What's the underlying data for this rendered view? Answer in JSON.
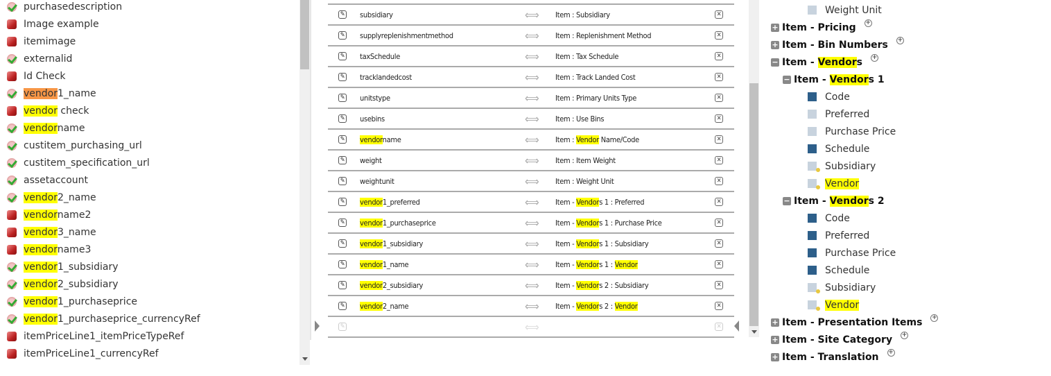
{
  "left_fields": [
    {
      "icon": "check",
      "parts": [
        [
          "purchasedescription",
          ""
        ]
      ]
    },
    {
      "icon": "cube",
      "parts": [
        [
          "Image example",
          ""
        ]
      ]
    },
    {
      "icon": "cube",
      "parts": [
        [
          "itemimage",
          ""
        ]
      ]
    },
    {
      "icon": "check",
      "parts": [
        [
          "externalid",
          ""
        ]
      ]
    },
    {
      "icon": "cube",
      "parts": [
        [
          "Id Check",
          ""
        ]
      ]
    },
    {
      "icon": "check",
      "parts": [
        [
          "vendor",
          "o"
        ],
        [
          "1_name",
          ""
        ]
      ]
    },
    {
      "icon": "cube",
      "parts": [
        [
          "vendor",
          "y"
        ],
        [
          " check",
          ""
        ]
      ]
    },
    {
      "icon": "check",
      "parts": [
        [
          "vendor",
          "y"
        ],
        [
          "name",
          ""
        ]
      ]
    },
    {
      "icon": "check",
      "parts": [
        [
          "custitem_purchasing_url",
          ""
        ]
      ]
    },
    {
      "icon": "check",
      "parts": [
        [
          "custitem_specification_url",
          ""
        ]
      ]
    },
    {
      "icon": "check",
      "parts": [
        [
          "assetaccount",
          ""
        ]
      ]
    },
    {
      "icon": "check",
      "parts": [
        [
          "vendor",
          "y"
        ],
        [
          "2_name",
          ""
        ]
      ]
    },
    {
      "icon": "cube",
      "parts": [
        [
          "vendor",
          "y"
        ],
        [
          "name2",
          ""
        ]
      ]
    },
    {
      "icon": "cube",
      "parts": [
        [
          "vendor",
          "y"
        ],
        [
          "3_name",
          ""
        ]
      ]
    },
    {
      "icon": "cube",
      "parts": [
        [
          "vendor",
          "y"
        ],
        [
          "name3",
          ""
        ]
      ]
    },
    {
      "icon": "check",
      "parts": [
        [
          "vendor",
          "y"
        ],
        [
          "1_subsidiary",
          ""
        ]
      ]
    },
    {
      "icon": "check",
      "parts": [
        [
          "vendor",
          "y"
        ],
        [
          "2_subsidiary",
          ""
        ]
      ]
    },
    {
      "icon": "check",
      "parts": [
        [
          "vendor",
          "y"
        ],
        [
          "1_purchaseprice",
          ""
        ]
      ]
    },
    {
      "icon": "check",
      "parts": [
        [
          "vendor",
          "y"
        ],
        [
          "1_purchaseprice_currencyRef",
          ""
        ]
      ]
    },
    {
      "icon": "cube",
      "parts": [
        [
          "itemPriceLine1_itemPriceTypeRef",
          ""
        ]
      ]
    },
    {
      "icon": "cube",
      "parts": [
        [
          "itemPriceLine1_currencyRef",
          ""
        ]
      ]
    }
  ],
  "mappings": [
    {
      "src": [
        [
          "subsidiary",
          ""
        ]
      ],
      "tgt": [
        [
          "Item : Subsidiary",
          ""
        ]
      ]
    },
    {
      "src": [
        [
          "supplyreplenishmentmethod",
          ""
        ]
      ],
      "tgt": [
        [
          "Item : Replenishment Method",
          ""
        ]
      ]
    },
    {
      "src": [
        [
          "taxSchedule",
          ""
        ]
      ],
      "tgt": [
        [
          "Item : Tax Schedule",
          ""
        ]
      ]
    },
    {
      "src": [
        [
          "tracklandedcost",
          ""
        ]
      ],
      "tgt": [
        [
          "Item : Track Landed Cost",
          ""
        ]
      ]
    },
    {
      "src": [
        [
          "unitstype",
          ""
        ]
      ],
      "tgt": [
        [
          "Item : Primary Units Type",
          ""
        ]
      ]
    },
    {
      "src": [
        [
          "usebins",
          ""
        ]
      ],
      "tgt": [
        [
          "Item : Use Bins",
          ""
        ]
      ]
    },
    {
      "src": [
        [
          "vendor",
          "y"
        ],
        [
          "name",
          ""
        ]
      ],
      "tgt": [
        [
          "Item : ",
          ""
        ],
        [
          "Vendor",
          "y"
        ],
        [
          " Name/Code",
          ""
        ]
      ]
    },
    {
      "src": [
        [
          "weight",
          ""
        ]
      ],
      "tgt": [
        [
          "Item : Item Weight",
          ""
        ]
      ]
    },
    {
      "src": [
        [
          "weightunit",
          ""
        ]
      ],
      "tgt": [
        [
          "Item : Weight Unit",
          ""
        ]
      ]
    },
    {
      "src": [
        [
          "vendor",
          "y"
        ],
        [
          "1_preferred",
          ""
        ]
      ],
      "tgt": [
        [
          "Item - ",
          ""
        ],
        [
          "Vendor",
          "y"
        ],
        [
          "s 1 : Preferred",
          ""
        ]
      ]
    },
    {
      "src": [
        [
          "vendor",
          "y"
        ],
        [
          "1_purchaseprice",
          ""
        ]
      ],
      "tgt": [
        [
          "Item - ",
          ""
        ],
        [
          "Vendor",
          "y"
        ],
        [
          "s 1 : Purchase Price",
          ""
        ]
      ]
    },
    {
      "src": [
        [
          "vendor",
          "y"
        ],
        [
          "1_subsidiary",
          ""
        ]
      ],
      "tgt": [
        [
          "Item - ",
          ""
        ],
        [
          "Vendor",
          "y"
        ],
        [
          "s 1 : Subsidiary",
          ""
        ]
      ]
    },
    {
      "src": [
        [
          "vendor",
          "y"
        ],
        [
          "1_name",
          ""
        ]
      ],
      "tgt": [
        [
          "Item - ",
          ""
        ],
        [
          "Vendor",
          "y"
        ],
        [
          "s 1 : ",
          ""
        ],
        [
          "Vendor",
          "y"
        ]
      ]
    },
    {
      "src": [
        [
          "vendor",
          "y"
        ],
        [
          "2_subsidiary",
          ""
        ]
      ],
      "tgt": [
        [
          "Item - ",
          ""
        ],
        [
          "Vendor",
          "y"
        ],
        [
          "s 2 : Subsidiary",
          ""
        ]
      ]
    },
    {
      "src": [
        [
          "vendor",
          "y"
        ],
        [
          "2_name",
          ""
        ]
      ],
      "tgt": [
        [
          "Item - ",
          ""
        ],
        [
          "Vendor",
          "y"
        ],
        [
          "s 2 : ",
          ""
        ],
        [
          "Vendor",
          "y"
        ]
      ]
    }
  ],
  "icons": {
    "edit": "✎",
    "arrow": "⟺",
    "delete": "✕",
    "plus": "+",
    "minus": "−",
    "add": "+"
  },
  "tree": [
    {
      "kind": "field",
      "icon": "light",
      "level": 2,
      "parts": [
        [
          "Weight Unit",
          ""
        ]
      ]
    },
    {
      "kind": "group",
      "state": "plus",
      "level": 0,
      "add": true,
      "parts": [
        [
          "Item - Pricing",
          ""
        ]
      ]
    },
    {
      "kind": "group",
      "state": "plus",
      "level": 0,
      "add": true,
      "parts": [
        [
          "Item - Bin Numbers",
          ""
        ]
      ]
    },
    {
      "kind": "group",
      "state": "minus",
      "level": 0,
      "add": true,
      "parts": [
        [
          "Item - ",
          ""
        ],
        [
          "Vendor",
          "y"
        ],
        [
          "s",
          ""
        ]
      ]
    },
    {
      "kind": "group",
      "state": "minus",
      "level": 1,
      "add": false,
      "parts": [
        [
          "Item - ",
          ""
        ],
        [
          "Vendor",
          "y"
        ],
        [
          "s 1",
          ""
        ]
      ]
    },
    {
      "kind": "field",
      "icon": "dark",
      "level": 2,
      "parts": [
        [
          "Code",
          ""
        ]
      ]
    },
    {
      "kind": "field",
      "icon": "light",
      "level": 2,
      "parts": [
        [
          "Preferred",
          ""
        ]
      ]
    },
    {
      "kind": "field",
      "icon": "light",
      "level": 2,
      "parts": [
        [
          "Purchase Price",
          ""
        ]
      ]
    },
    {
      "kind": "field",
      "icon": "dark",
      "level": 2,
      "parts": [
        [
          "Schedule",
          ""
        ]
      ]
    },
    {
      "kind": "field",
      "icon": "key",
      "level": 2,
      "parts": [
        [
          "Subsidiary",
          ""
        ]
      ]
    },
    {
      "kind": "field",
      "icon": "key",
      "level": 2,
      "parts": [
        [
          "Vendor",
          "y"
        ]
      ]
    },
    {
      "kind": "group",
      "state": "minus",
      "level": 1,
      "add": false,
      "parts": [
        [
          "Item - ",
          ""
        ],
        [
          "Vendor",
          "y"
        ],
        [
          "s 2",
          ""
        ]
      ]
    },
    {
      "kind": "field",
      "icon": "dark",
      "level": 2,
      "parts": [
        [
          "Code",
          ""
        ]
      ]
    },
    {
      "kind": "field",
      "icon": "dark",
      "level": 2,
      "parts": [
        [
          "Preferred",
          ""
        ]
      ]
    },
    {
      "kind": "field",
      "icon": "dark",
      "level": 2,
      "parts": [
        [
          "Purchase Price",
          ""
        ]
      ]
    },
    {
      "kind": "field",
      "icon": "dark",
      "level": 2,
      "parts": [
        [
          "Schedule",
          ""
        ]
      ]
    },
    {
      "kind": "field",
      "icon": "key",
      "level": 2,
      "parts": [
        [
          "Subsidiary",
          ""
        ]
      ]
    },
    {
      "kind": "field",
      "icon": "key",
      "level": 2,
      "parts": [
        [
          "Vendor",
          "y"
        ]
      ]
    },
    {
      "kind": "group",
      "state": "plus",
      "level": 0,
      "add": true,
      "parts": [
        [
          "Item - Presentation Items",
          ""
        ]
      ]
    },
    {
      "kind": "group",
      "state": "plus",
      "level": 0,
      "add": true,
      "parts": [
        [
          "Item - Site Category",
          ""
        ]
      ]
    },
    {
      "kind": "group",
      "state": "plus",
      "level": 0,
      "add": true,
      "parts": [
        [
          "Item - Translation",
          ""
        ]
      ]
    }
  ]
}
